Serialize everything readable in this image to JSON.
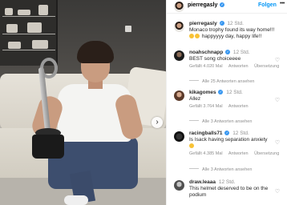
{
  "post": {
    "username": "pierregasly",
    "follow_label": "Folgen",
    "more_label": "•••",
    "photo_next_label": "›",
    "caption_user": "pierregasly",
    "caption_time": "12 Std.",
    "caption_line1": "Monaco trophy found its way home!!!",
    "caption_line2": "happyyyy day, happy life!!"
  },
  "comments": [
    {
      "user": "noahschnapp",
      "time": "12 Std.",
      "text": "BEST song choiceeee",
      "likes": "Gefällt 4.020 Mal",
      "reply": "Antworten",
      "translate": "Übersetzung",
      "replies": "Alle 25 Antworten ansehen"
    },
    {
      "user": "kikagomes",
      "time": "12 Std.",
      "text": "Allez",
      "likes": "Gefällt 3.764 Mal",
      "reply": "Antworten",
      "replies": "Alle 3 Antworten ansehen"
    },
    {
      "user": "racingballs71",
      "time": "12 Std.",
      "text": "Is Isack having separation anxiety",
      "likes": "Gefällt 4.385 Mal",
      "reply": "Antworten",
      "translate": "Übersetzung",
      "replies": "Alle 3 Antworten ansehen"
    },
    {
      "user": "draw.leaaa",
      "time": "12 Std.",
      "text": "This helmet deserved to be on the podium"
    }
  ],
  "icons": {
    "heart": "♡",
    "verified": "✓",
    "trophy": "trophy-icon"
  },
  "colors": {
    "link": "#0095f6",
    "verified": "#3897f0",
    "muted": "#8e8e8e"
  }
}
